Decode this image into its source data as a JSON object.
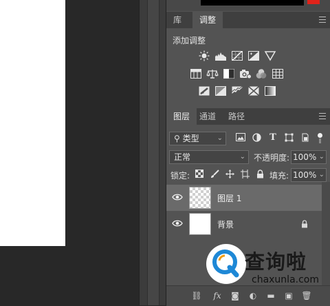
{
  "adjust_panel": {
    "tabs": [
      {
        "label": "库",
        "active": false
      },
      {
        "label": "调整",
        "active": true
      }
    ],
    "section_title": "添加调整",
    "icons_row1": [
      "brightness-contrast-icon",
      "levels-icon",
      "curves-icon",
      "exposure-icon",
      "vibrance-triangle-icon"
    ],
    "icons_row2": [
      "hue-saturation-icon",
      "color-balance-icon",
      "black-white-icon",
      "photo-filter-icon",
      "channel-mixer-icon",
      "color-lookup-icon"
    ],
    "icons_row3": [
      "invert-icon",
      "posterize-icon",
      "threshold-icon",
      "selective-color-icon",
      "gradient-map-icon"
    ]
  },
  "layers_panel": {
    "tabs": [
      {
        "label": "图层",
        "active": true
      },
      {
        "label": "通道",
        "active": false
      },
      {
        "label": "路径",
        "active": false
      }
    ],
    "filter_label": "类型",
    "blend_mode": "正常",
    "opacity_label": "不透明度:",
    "opacity_value": "100%",
    "lock_label": "锁定:",
    "fill_label": "填充:",
    "fill_value": "100%",
    "layers": [
      {
        "name": "图层 1",
        "selected": true,
        "thumb": "transparent",
        "locked": false
      },
      {
        "name": "背景",
        "selected": false,
        "thumb": "white",
        "locked": true
      }
    ],
    "bottom_icons": [
      "link-icon",
      "fx-icon",
      "mask-icon",
      "adjustment-icon",
      "group-icon",
      "new-layer-icon",
      "trash-icon"
    ],
    "fx_label": "fx"
  },
  "watermark": {
    "title": "查询啦",
    "url": "chaxunla.com"
  },
  "colors": {
    "panel_bg": "#535353",
    "tabbar_bg": "#3f3f3f",
    "selected_layer": "#6a6a6a",
    "accent_blue": "#1e88d6",
    "top_red": "#e0231a"
  }
}
